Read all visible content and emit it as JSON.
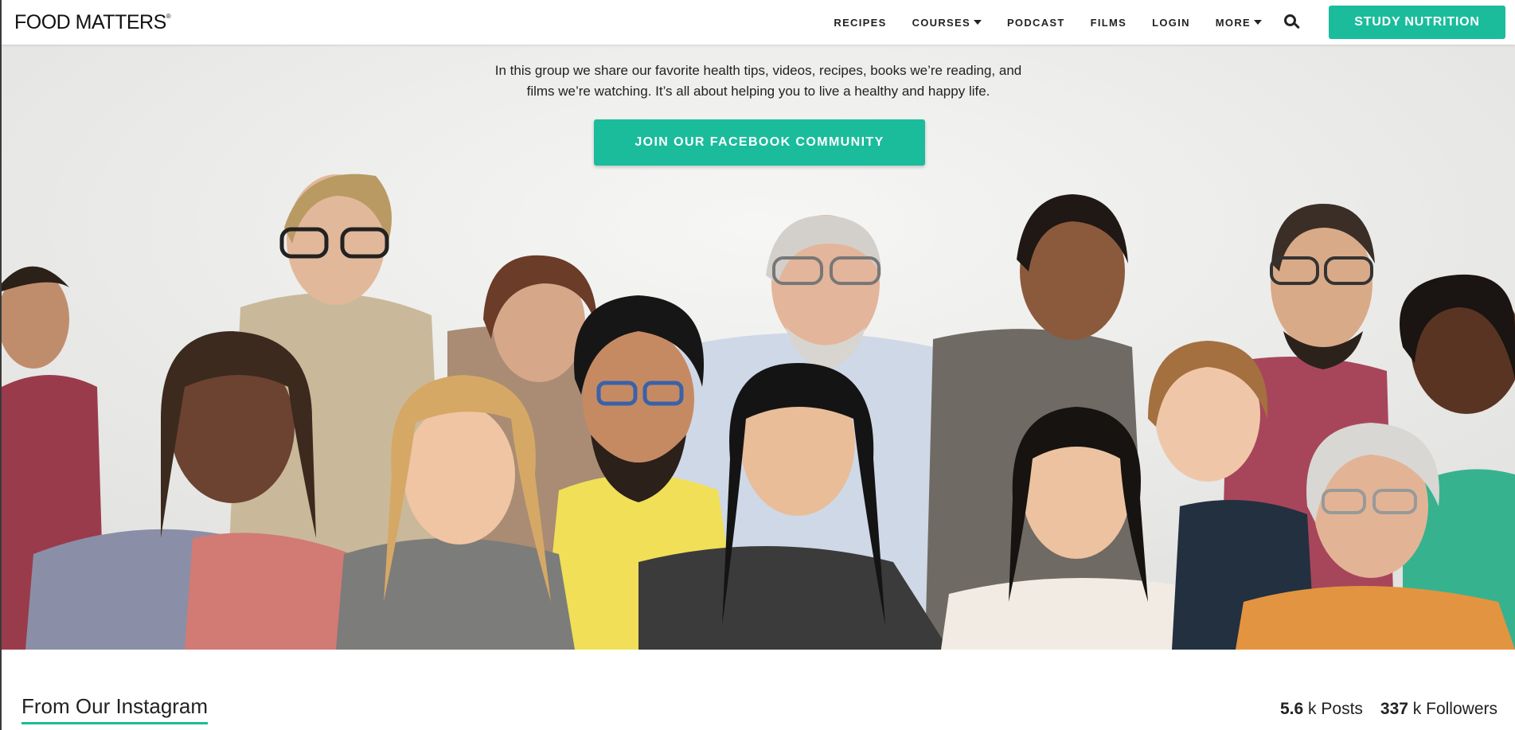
{
  "header": {
    "logo": "FOOD MATTERS",
    "logo_mark": "®",
    "nav": {
      "recipes": "RECIPES",
      "courses": "COURSES",
      "podcast": "PODCAST",
      "films": "FILMS",
      "login": "LOGIN",
      "more": "MORE"
    },
    "search_icon": "search-icon",
    "cta": "STUDY NUTRITION"
  },
  "hero": {
    "description_line1": "In this group we share our favorite health tips, videos, recipes, books we’re reading, and",
    "description_line2": "films we’re watching. It’s all about helping you to live a healthy and happy life.",
    "button": "JOIN OUR FACEBOOK COMMUNITY",
    "image": "group-of-smiling-people-photo"
  },
  "instagram": {
    "title": "From Our Instagram",
    "posts_value": "5.6",
    "posts_label": "k Posts",
    "followers_value": "337",
    "followers_label": "k Followers"
  },
  "colors": {
    "accent": "#1abc9c",
    "text": "#222222"
  }
}
